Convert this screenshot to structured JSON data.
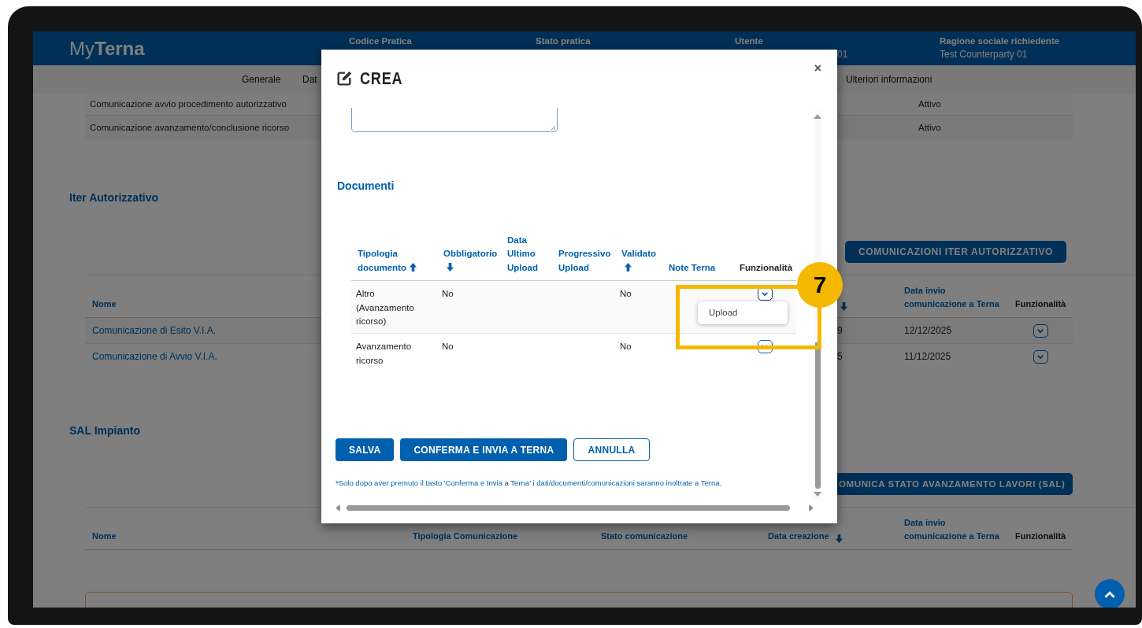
{
  "header": {
    "logo": [
      "My",
      "Terna"
    ],
    "fields": [
      {
        "label": "Codice Pratica"
      },
      {
        "label": "Stato pratica"
      },
      {
        "label": "Utente",
        "value": "01"
      },
      {
        "label": "Ragione sociale richiedente",
        "value": "Test Counterparty 01"
      }
    ]
  },
  "tabs": [
    "Generale",
    "Dat",
    "Ulteriori informazioni"
  ],
  "notifications": [
    {
      "name": "Comunicazione avvio procedimento autorizzativo",
      "status": "Attivo"
    },
    {
      "name": "Comunicazione avanzamento/conclusione ricorso",
      "status": "Attivo"
    }
  ],
  "iter": {
    "title": "Iter Autorizzativo",
    "button": "COMUNICAZIONI ITER AUTORIZZATIVO",
    "columns": [
      {
        "label": "Nome",
        "kind": "link"
      },
      {
        "kind": "sort-down"
      },
      {
        "label": "Data invio comunicazione a Terna",
        "kind": "link"
      },
      {
        "label": "Funzionalità",
        "kind": "plain"
      }
    ],
    "rows": [
      {
        "name": "Comunicazione di Esito V.I.A.",
        "column_2": "9",
        "date": "12/12/2025"
      },
      {
        "name": "Comunicazione di Avvio V.I.A.",
        "column_2": "5",
        "date": "11/12/2025"
      }
    ]
  },
  "sal": {
    "title": "SAL Impianto",
    "button": "OMUNICA STATO AVANZAMENTO LAVORI (SAL)",
    "columns": [
      {
        "label": "Nome",
        "kind": "link"
      },
      {
        "label": "Tipologia Comunicazione",
        "kind": "link"
      },
      {
        "label": "Stato comunicazione",
        "kind": "link"
      },
      {
        "label": "Data creazione",
        "kind": "sort-down"
      },
      {
        "label": "Data invio comunicazione a Terna",
        "kind": "link"
      },
      {
        "label": "Funzionalità",
        "kind": "plain"
      }
    ]
  },
  "modal": {
    "title": "CREA",
    "close": "×",
    "section": "Documenti",
    "columns": [
      {
        "label": "Tipologia documento",
        "kind": "sort-up"
      },
      {
        "label": "Obbligatorio",
        "kind": "sort-down"
      },
      {
        "label": "Data Ultimo Upload",
        "kind": "link"
      },
      {
        "label": "Progressivo Upload",
        "kind": "link"
      },
      {
        "label": "Validato",
        "kind": "sort-up"
      },
      {
        "label": "Note Terna",
        "kind": "link"
      },
      {
        "label": "Funzionalità",
        "kind": "plain"
      }
    ],
    "rows": [
      {
        "tipologia": "Altro (Avanzamento ricorso)",
        "obbligatorio": "No",
        "validato": "No",
        "expanded": true
      },
      {
        "tipologia": "Avanzamento ricorso",
        "obbligatorio": "No",
        "validato": "No",
        "expanded": false
      }
    ],
    "menu": [
      "Upload"
    ],
    "buttons": [
      {
        "label": "SALVA",
        "kind": "primary"
      },
      {
        "label": "CONFERMA E INVIA A TERNA",
        "kind": "primary"
      },
      {
        "label": "ANNULLA",
        "kind": "outline"
      }
    ],
    "note": "*Solo dopo aver premuto il tasto 'Conferma e Invia a Terna' i dati/documenti/comunicazioni saranno inoltrate a Terna."
  },
  "callout": {
    "number": "7"
  }
}
